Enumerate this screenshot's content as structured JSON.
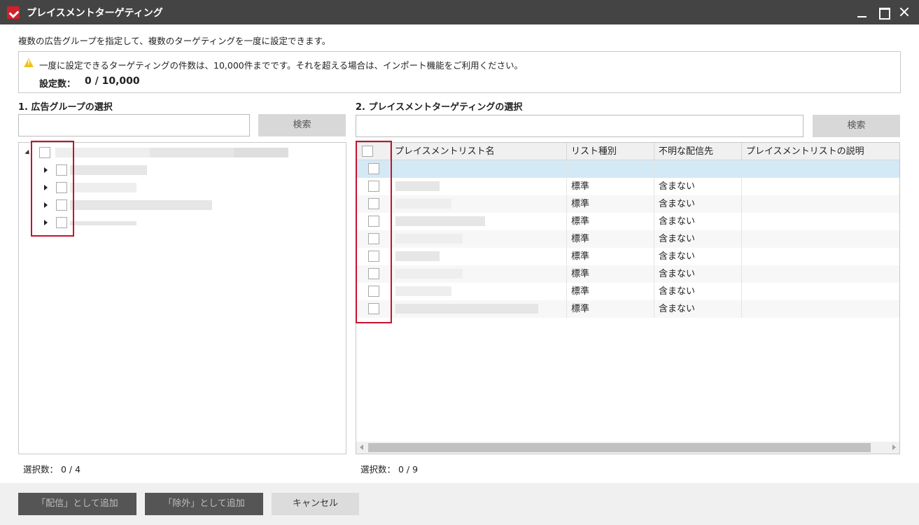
{
  "window": {
    "title": "プレイスメントターゲティング",
    "description": "複数の広告グループを指定して、複数のターゲティングを一度に設定できます。"
  },
  "notice": {
    "text": "一度に設定できるターゲティングの件数は、10,000件までです。それを超える場合は、インポート機能をご利用ください。",
    "count_label": "設定数：",
    "count_value": "0 / 10,000"
  },
  "left_panel": {
    "title": "1. 広告グループの選択",
    "search_placeholder": "",
    "search_button": "検索",
    "selection_count": "選択数：  0 / 4"
  },
  "right_panel": {
    "title": "2. プレイスメントターゲティングの選択",
    "search_placeholder": "",
    "search_button": "検索",
    "columns": [
      "プレイスメントリスト名",
      "リスト種別",
      "不明な配信先",
      "プレイスメントリストの説明"
    ],
    "rows": [
      {
        "list_type": "",
        "unknown_destination": ""
      },
      {
        "list_type": "標準",
        "unknown_destination": "含まない"
      },
      {
        "list_type": "標準",
        "unknown_destination": "含まない"
      },
      {
        "list_type": "標準",
        "unknown_destination": "含まない"
      },
      {
        "list_type": "標準",
        "unknown_destination": "含まない"
      },
      {
        "list_type": "標準",
        "unknown_destination": "含まない"
      },
      {
        "list_type": "標準",
        "unknown_destination": "含まない"
      },
      {
        "list_type": "標準",
        "unknown_destination": "含まない"
      },
      {
        "list_type": "標準",
        "unknown_destination": "含まない"
      }
    ],
    "selection_count": "選択数：  0 / 9"
  },
  "footer": {
    "add_delivery_button": "「配信」として追加",
    "add_exclusion_button": "「除外」として追加",
    "cancel_button": "キャンセル"
  },
  "colors": {
    "titlebar": "#444444",
    "highlight": "#c8102e",
    "selected_row": "#d3e9f5",
    "warning": "#f2c21b"
  }
}
